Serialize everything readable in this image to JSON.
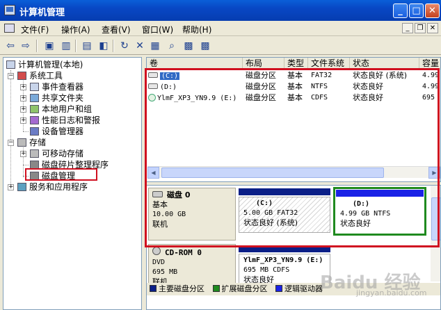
{
  "window": {
    "title": "计算机管理",
    "controls": {
      "minimize": "_",
      "maximize": "□",
      "close": "✕"
    }
  },
  "menu": {
    "items": [
      "文件(F)",
      "操作(A)",
      "查看(V)",
      "窗口(W)",
      "帮助(H)"
    ],
    "mdi": {
      "minimize": "_",
      "restore": "❐",
      "close": "✕"
    }
  },
  "toolbar": {
    "icons": [
      "back-arrow-icon",
      "forward-arrow-icon",
      "up-folder-icon",
      "show-hide-tree-icon",
      "properties-icon",
      "help-icon",
      "refresh-icon",
      "delete-icon",
      "drive-properties-icon",
      "search-icon",
      "disk-options-icon"
    ],
    "glyphs": [
      "⇦",
      "⇨",
      "▣",
      "▥",
      "▤",
      "◧",
      "↻",
      "✕",
      "▦",
      "⌕",
      "▩"
    ]
  },
  "tree": {
    "root": "计算机管理(本地)",
    "system_tools": "系统工具",
    "event_viewer": "事件查看器",
    "shared_folders": "共享文件夹",
    "local_users": "本地用户和组",
    "perf_logs": "性能日志和警报",
    "device_manager": "设备管理器",
    "storage": "存储",
    "removable": "可移动存储",
    "defrag": "磁盘碎片整理程序",
    "disk_mgmt": "磁盘管理",
    "services": "服务和应用程序",
    "expanders": {
      "plus": "+",
      "minus": "−"
    }
  },
  "list": {
    "columns": [
      "卷",
      "布局",
      "类型",
      "文件系统",
      "状态",
      "容量"
    ],
    "rows": [
      {
        "volume": "(C:)",
        "layout": "磁盘分区",
        "type": "基本",
        "fs": "FAT32",
        "status": "状态良好 (系统)",
        "capacity": "4.99"
      },
      {
        "volume": "(D:)",
        "layout": "磁盘分区",
        "type": "基本",
        "fs": "NTFS",
        "status": "状态良好",
        "capacity": "4.99"
      },
      {
        "volume": "YlmF_XP3_YN9.9 (E:)",
        "layout": "磁盘分区",
        "type": "基本",
        "fs": "CDFS",
        "status": "状态良好",
        "capacity": "695"
      }
    ],
    "scroll": {
      "left": "◀",
      "right": "▶"
    }
  },
  "disks": [
    {
      "name": "磁盘 0",
      "kind": "基本",
      "size": "10.00 GB",
      "state": "联机",
      "partitions": [
        {
          "label": "(C:)",
          "detail": "5.00 GB FAT32",
          "status": "状态良好 (系统)"
        },
        {
          "label": "(D:)",
          "detail": "4.99 GB NTFS",
          "status": "状态良好"
        }
      ]
    },
    {
      "name": "CD-ROM 0",
      "kind": "DVD",
      "size": "695 MB",
      "state": "联机",
      "partitions": [
        {
          "label": "YlmF_XP3_YN9.9  (E:)",
          "detail": "695 MB CDFS",
          "status": "状态良好"
        }
      ]
    }
  ],
  "legend": {
    "primary": "主要磁盘分区",
    "extended": "扩展磁盘分区",
    "logical": "逻辑驱动器"
  },
  "colors": {
    "primary": "#0b1f87",
    "extended": "#1f8a1f",
    "logical": "#1a22e6",
    "highlight": "#d01020",
    "selection": "#316ac5"
  },
  "watermark": {
    "text": "Baidu 经验",
    "sub": "jingyan.baidu.com"
  }
}
